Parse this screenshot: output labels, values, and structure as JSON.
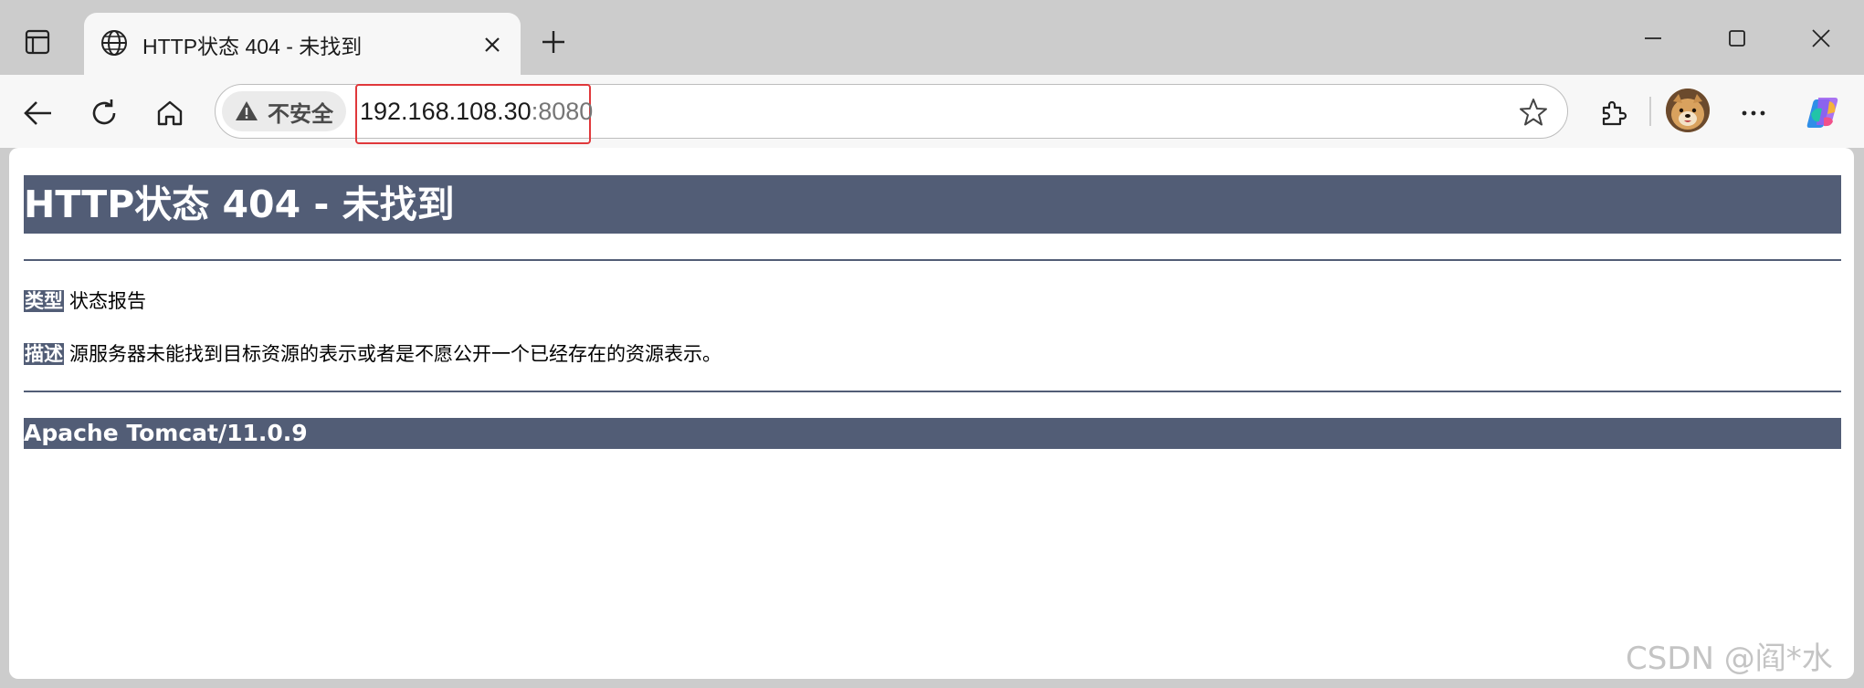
{
  "browser": {
    "tab": {
      "title": "HTTP状态 404 - 未找到"
    },
    "address_bar": {
      "security_label": "不安全",
      "url_host": "192.168.108.30",
      "url_port": ":8080"
    },
    "icons": {
      "tab_actions": "tab-actions-icon",
      "favicon": "globe-icon",
      "close_tab": "close-icon",
      "new_tab": "plus-icon",
      "minimize": "minimize-icon",
      "maximize": "maximize-icon",
      "close_window": "close-icon",
      "back": "back-arrow-icon",
      "reload": "reload-icon",
      "home": "home-icon",
      "warning": "warning-icon",
      "favorite": "star-icon",
      "extensions": "puzzle-icon",
      "more": "more-icon",
      "copilot": "copilot-icon"
    },
    "colors": {
      "highlight_border": "#e0383b"
    }
  },
  "page": {
    "heading": "HTTP状态 404 - 未找到",
    "type_label": "类型",
    "type_value": "状态报告",
    "description_label": "描述",
    "description_value": "源服务器未能找到目标资源的表示或者是不愿公开一个已经存在的资源表示。",
    "server_footer": "Apache Tomcat/11.0.9",
    "colors": {
      "banner": "#525d76"
    }
  },
  "watermark": "CSDN @阎*水"
}
